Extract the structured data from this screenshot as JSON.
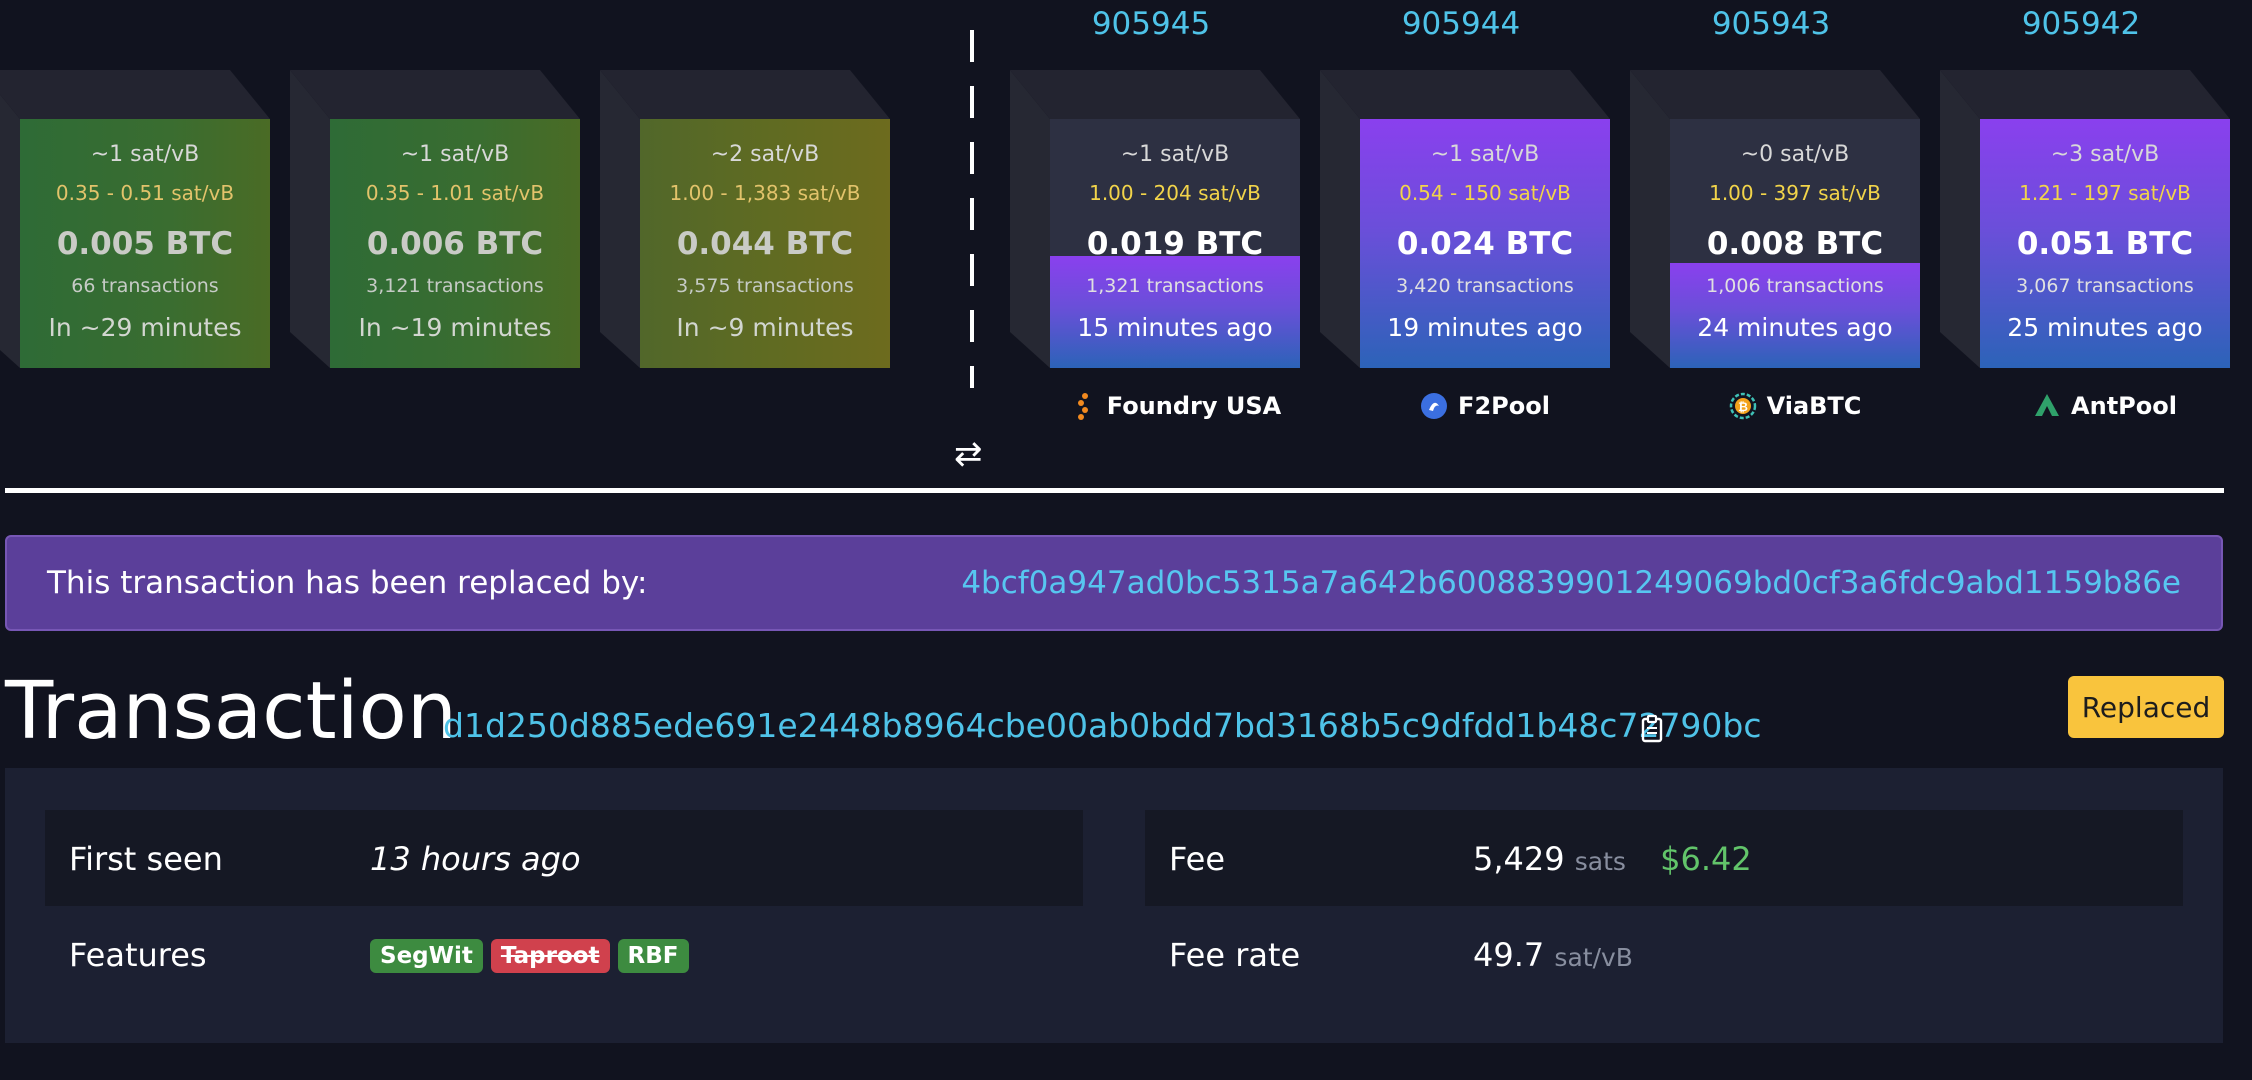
{
  "pending_blocks": [
    {
      "median_fee": "~1 sat/vB",
      "fee_range": "0.35 - 0.51 sat/vB",
      "total": "0.005 BTC",
      "tx_count": "66 transactions",
      "eta": "In ~29 minutes"
    },
    {
      "median_fee": "~1 sat/vB",
      "fee_range": "0.35 - 1.01 sat/vB",
      "total": "0.006 BTC",
      "tx_count": "3,121 transactions",
      "eta": "In ~19 minutes"
    },
    {
      "median_fee": "~2 sat/vB",
      "fee_range": "1.00 - 1,383 sat/vB",
      "total": "0.044 BTC",
      "tx_count": "3,575 transactions",
      "eta": "In ~9 minutes"
    }
  ],
  "mined_blocks": [
    {
      "height": "905945",
      "median_fee": "~1 sat/vB",
      "fee_range": "1.00 - 204 sat/vB",
      "total": "0.019 BTC",
      "tx_count": "1,321 transactions",
      "age": "15 minutes ago",
      "pool": "Foundry USA",
      "fill": 0.45
    },
    {
      "height": "905944",
      "median_fee": "~1 sat/vB",
      "fee_range": "0.54 - 150 sat/vB",
      "total": "0.024 BTC",
      "tx_count": "3,420 transactions",
      "age": "19 minutes ago",
      "pool": "F2Pool",
      "fill": 1.0
    },
    {
      "height": "905943",
      "median_fee": "~0 sat/vB",
      "fee_range": "1.00 - 397 sat/vB",
      "total": "0.008 BTC",
      "tx_count": "1,006 transactions",
      "age": "24 minutes ago",
      "pool": "ViaBTC",
      "fill": 0.42
    },
    {
      "height": "905942",
      "median_fee": "~3 sat/vB",
      "fee_range": "1.21 - 197 sat/vB",
      "total": "0.051 BTC",
      "tx_count": "3,067 transactions",
      "age": "25 minutes ago",
      "pool": "AntPool",
      "fill": 1.0
    }
  ],
  "replaced": {
    "message": "This transaction has been replaced by:",
    "txid": "4bcf0a947ad0bc5315a7a642b6008839901249069bd0cf3a6fdc9abd1159b86e"
  },
  "transaction": {
    "title": "Transaction",
    "txid": "d1d250d885ede691e2448b8964cbe00ab0bdd7bd3168b5c9dfdd1b48c72790bc",
    "status_badge": "Replaced"
  },
  "details": {
    "first_seen_label": "First seen",
    "first_seen_value": "13 hours ago",
    "features_label": "Features",
    "features": [
      "SegWit",
      "Taproot",
      "RBF"
    ],
    "fee_label": "Fee",
    "fee_sats": "5,429",
    "fee_unit": "sats",
    "fee_usd": "$6.42",
    "fee_rate_label": "Fee rate",
    "fee_rate_value": "49.7",
    "fee_rate_unit": "sat/vB"
  },
  "colors": {
    "accent": "#4fc3e8",
    "badge": "#f9c43d",
    "replaced_bg": "#5b3f9a",
    "usd": "#62c46a"
  }
}
